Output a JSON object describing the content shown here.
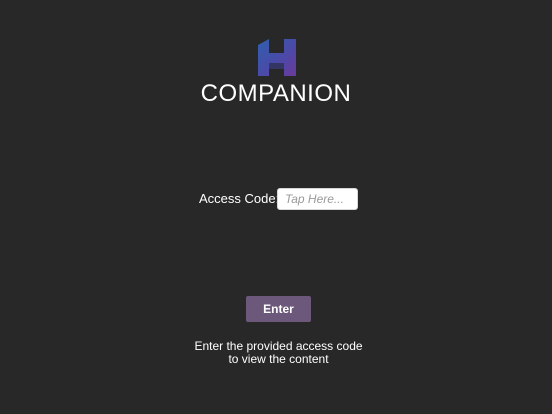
{
  "brand": {
    "logo_icon": "h-logo-icon",
    "name": "COMPANION",
    "colors": {
      "logo_blue": "#2f5fae",
      "logo_purple": "#6a3a9c",
      "background": "#282828"
    }
  },
  "access": {
    "label": "Access Code:",
    "value": "",
    "placeholder": "Tap Here..."
  },
  "enter_button": {
    "label": "Enter",
    "color": "#6b587a"
  },
  "help": {
    "line1": "Enter the provided access code",
    "line2": "to view the content"
  }
}
